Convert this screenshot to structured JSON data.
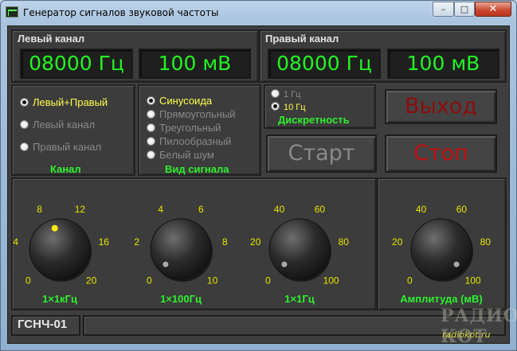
{
  "window": {
    "title": "Генератор сигналов звуковой частоты",
    "min_glyph": "–",
    "max_glyph": "□",
    "close_glyph": "✕"
  },
  "left": {
    "title": "Левый канал",
    "freq": "08000 Гц",
    "level": "100 мВ"
  },
  "right": {
    "title": "Правый канал",
    "freq": "08000 Гц",
    "level": "100 мВ"
  },
  "channel": {
    "label": "Канал",
    "options": [
      "Левый+Правый",
      "Левый канал",
      "Правый канал"
    ],
    "selected": 0
  },
  "waveform": {
    "label": "Вид сигнала",
    "options": [
      "Синусоида",
      "Прямоугольный",
      "Треугольный",
      "Пилообразный",
      "Белый шум"
    ],
    "selected": 0
  },
  "step": {
    "label": "Дискретность",
    "options": [
      "1 Гц",
      "10 Гц"
    ],
    "selected": 1
  },
  "buttons": {
    "exit": "Выход",
    "start": "Старт",
    "stop": "Стоп"
  },
  "colors": {
    "lcd_text": "#22f522",
    "accent_green": "#2ef02e",
    "scale_yellow": "#e6e600",
    "exit_red": "#8b0d0d",
    "stop_red": "#c31010",
    "start_gray": "#8a8a8a"
  },
  "knobs": [
    {
      "caption": "1×1кГц",
      "ticks": [
        "0",
        "4",
        "8",
        "12",
        "16",
        "20"
      ],
      "max": 20,
      "value": 9,
      "indicator": "yellow"
    },
    {
      "caption": "1×100Гц",
      "ticks": [
        "0",
        "2",
        "4",
        "6",
        "8",
        "10"
      ],
      "max": 10,
      "value": 0,
      "indicator": "gray"
    },
    {
      "caption": "1×1Гц",
      "ticks": [
        "0",
        "20",
        "40",
        "60",
        "80",
        "100"
      ],
      "max": 100,
      "value": 0,
      "indicator": "gray"
    },
    {
      "caption": "Амплитуда (мВ)",
      "ticks": [
        "0",
        "20",
        "40",
        "60",
        "80",
        "100"
      ],
      "max": 100,
      "value": 100,
      "indicator": "gray"
    }
  ],
  "status": {
    "model": "ГСНЧ-01",
    "message": ""
  },
  "watermark": {
    "text1": "РАДИО КОТ",
    "text2": "radiokot.ru"
  }
}
